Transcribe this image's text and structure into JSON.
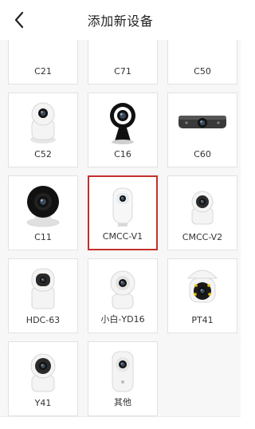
{
  "header": {
    "title": "添加新设备",
    "back_icon": "chevron-left-icon"
  },
  "devices": [
    {
      "label": "C21",
      "icon": "camera-c21-icon",
      "selected": false
    },
    {
      "label": "C71",
      "icon": "camera-c71-icon",
      "selected": false
    },
    {
      "label": "C50",
      "icon": "camera-c50-icon",
      "selected": false
    },
    {
      "label": "C52",
      "icon": "camera-c52-icon",
      "selected": false
    },
    {
      "label": "C16",
      "icon": "camera-c16-icon",
      "selected": false
    },
    {
      "label": "C60",
      "icon": "camera-c60-icon",
      "selected": false
    },
    {
      "label": "C11",
      "icon": "camera-c11-icon",
      "selected": false
    },
    {
      "label": "CMCC-V1",
      "icon": "camera-cmcc-v1-icon",
      "selected": true
    },
    {
      "label": "CMCC-V2",
      "icon": "camera-cmcc-v2-icon",
      "selected": false
    },
    {
      "label": "HDC-63",
      "icon": "camera-hdc-63-icon",
      "selected": false
    },
    {
      "label": "小白-YD16",
      "icon": "camera-yd16-icon",
      "selected": false
    },
    {
      "label": "PT41",
      "icon": "camera-pt41-icon",
      "selected": false
    },
    {
      "label": "Y41",
      "icon": "camera-y41-icon",
      "selected": false
    },
    {
      "label": "其他",
      "icon": "camera-other-icon",
      "selected": false
    }
  ],
  "colors": {
    "selected_border": "#c4302b",
    "card_border": "#e2e2e2",
    "background": "#f7f7f7"
  }
}
